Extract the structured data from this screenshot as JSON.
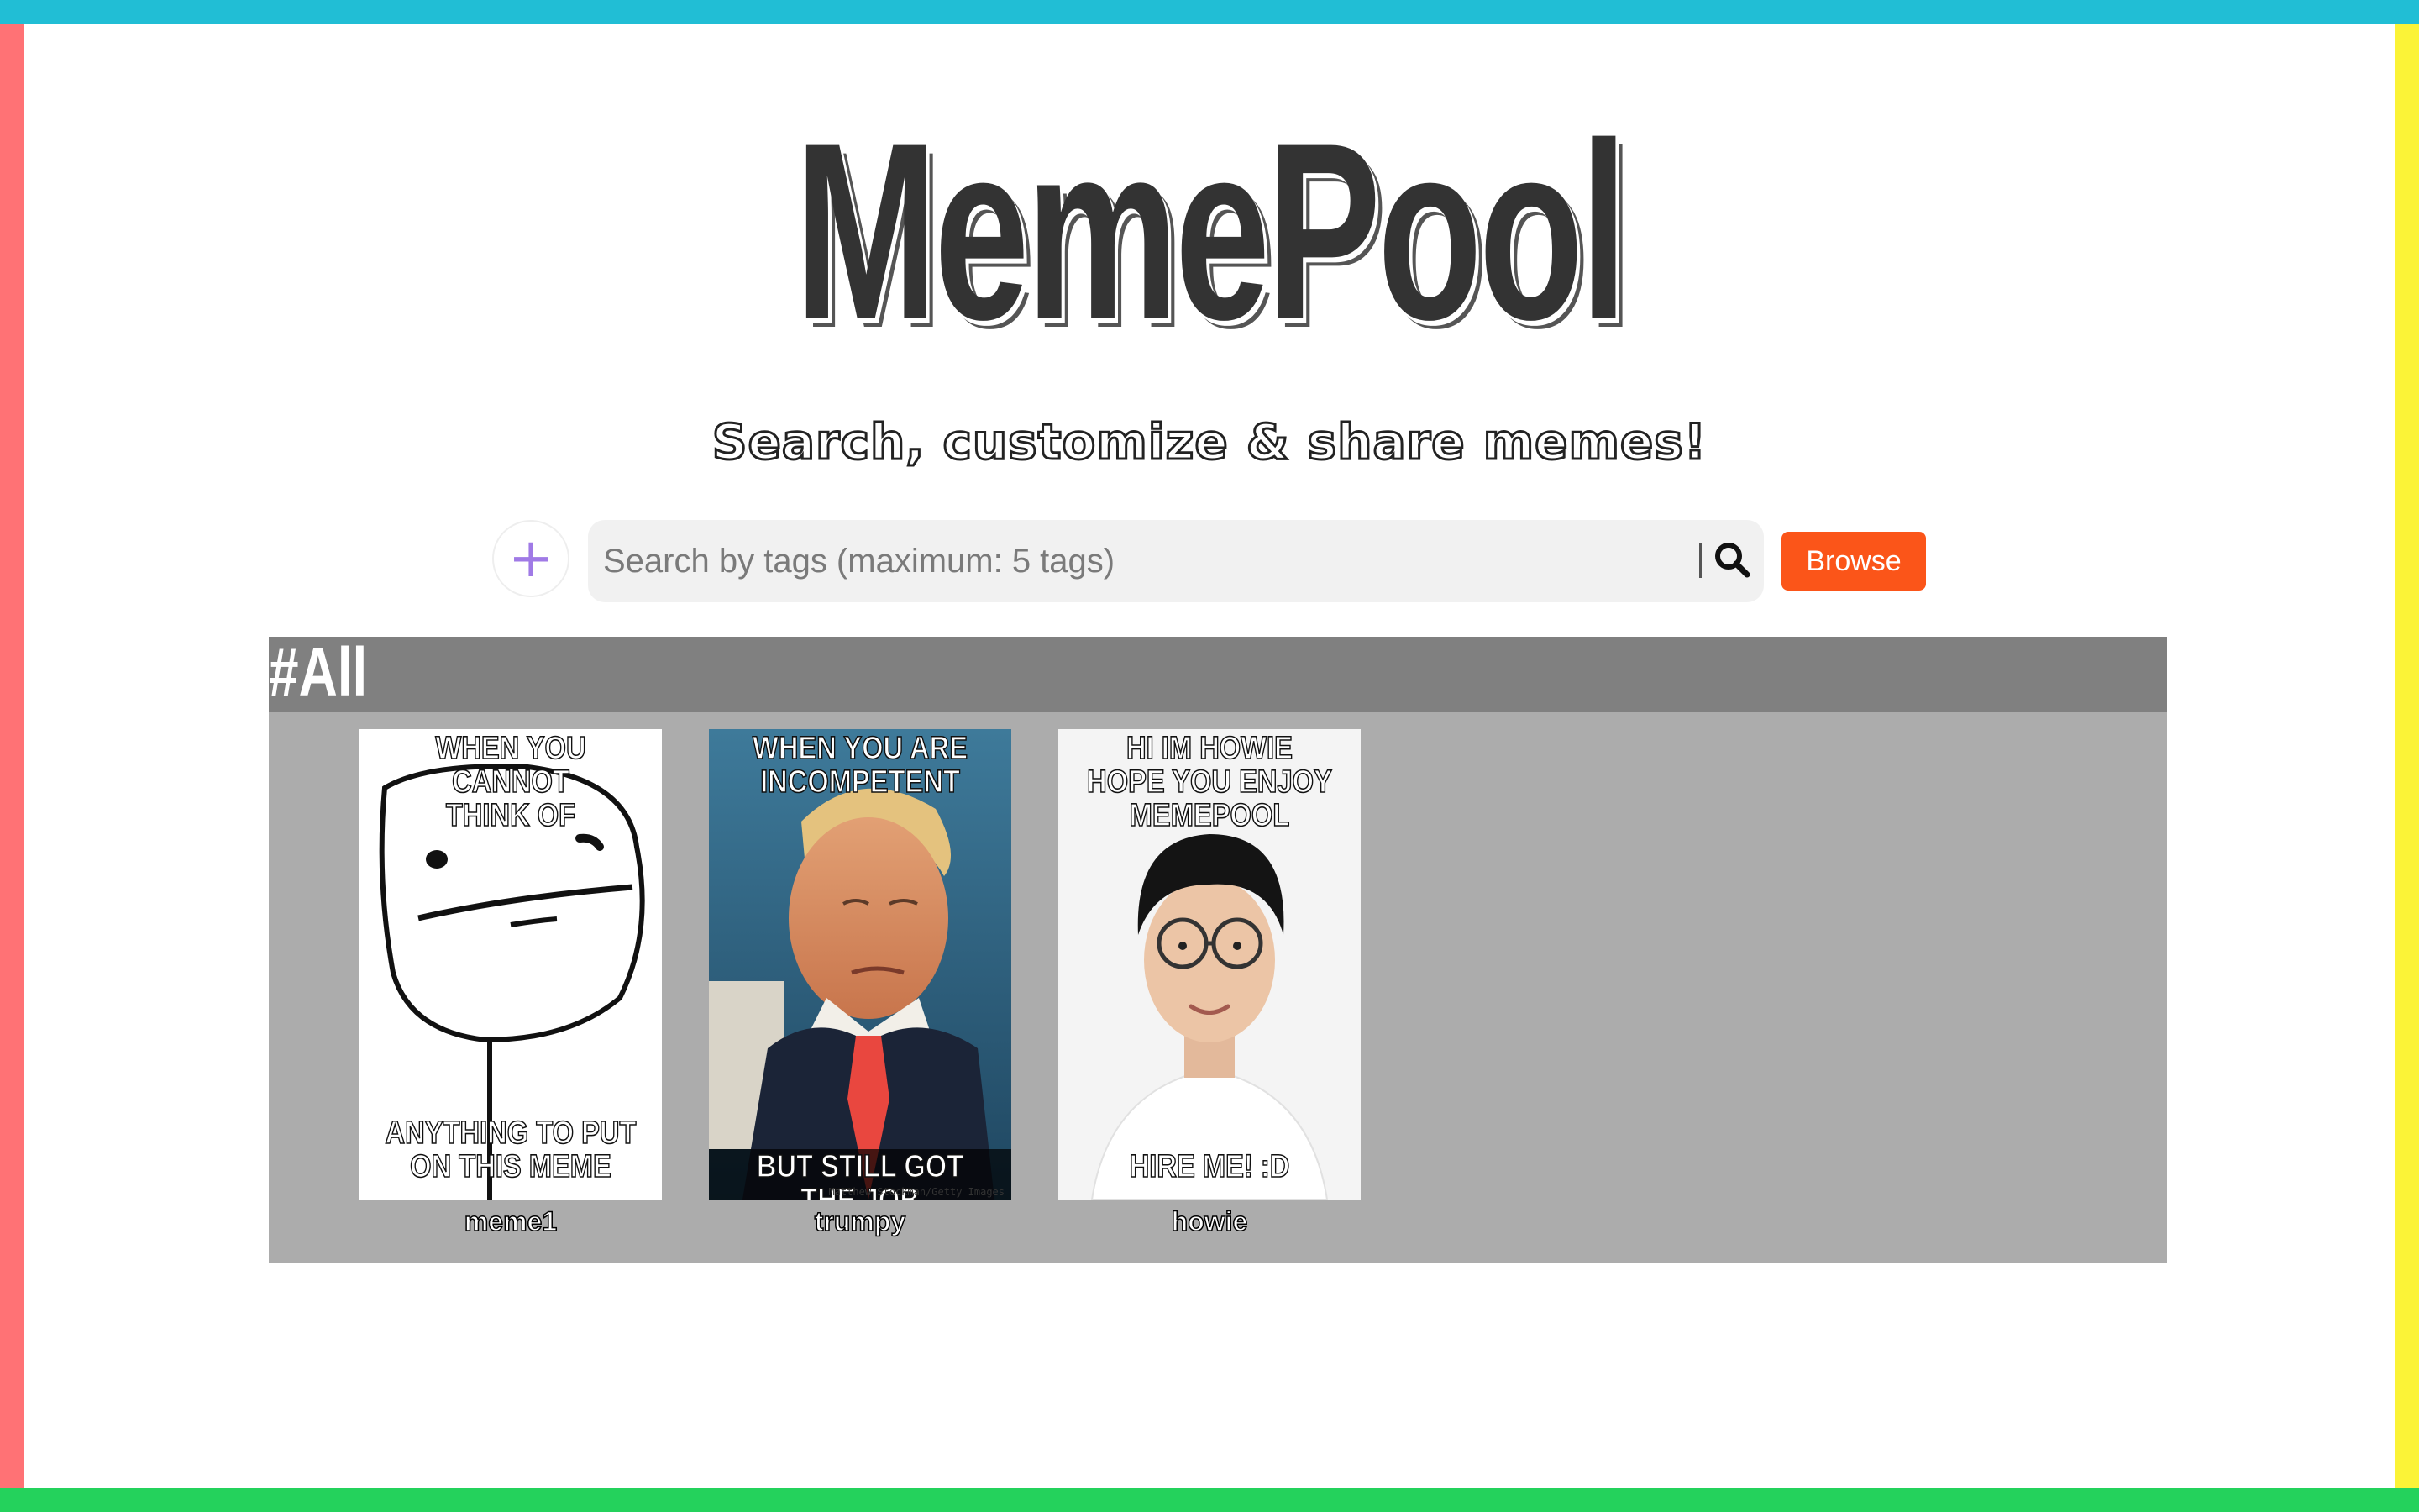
{
  "app": {
    "logo": "MemePool",
    "tagline": "Search, customize & share memes!"
  },
  "colors": {
    "border_top": "#21bed5",
    "border_left": "#ff7275",
    "border_right": "#fbf337",
    "border_bottom": "#24d25c",
    "browse_button": "#fb5519",
    "add_icon": "#a07ae6"
  },
  "toolbar": {
    "add_icon": "plus-icon",
    "search_placeholder": "Search by tags (maximum: 5 tags)",
    "search_value": "",
    "search_icon": "magnifier-icon",
    "browse_label": "Browse"
  },
  "gallery": {
    "title": "#All",
    "memes": [
      {
        "name": "meme1",
        "top_text": "WHEN YOU CANNOT\nTHINK OF",
        "bottom_text": "ANYTHING TO PUT\nON THIS MEME"
      },
      {
        "name": "trumpy",
        "top_text": "WHEN YOU ARE\nINCOMPETENT",
        "bottom_text": "BUT STILL GOT THE JOB",
        "credit": "Matthew Stockman/Getty Images"
      },
      {
        "name": "howie",
        "top_text": "HI IM HOWIE\nHOPE YOU ENJOY\nMEMEPOOL",
        "bottom_text": "HIRE ME! :D"
      }
    ]
  }
}
